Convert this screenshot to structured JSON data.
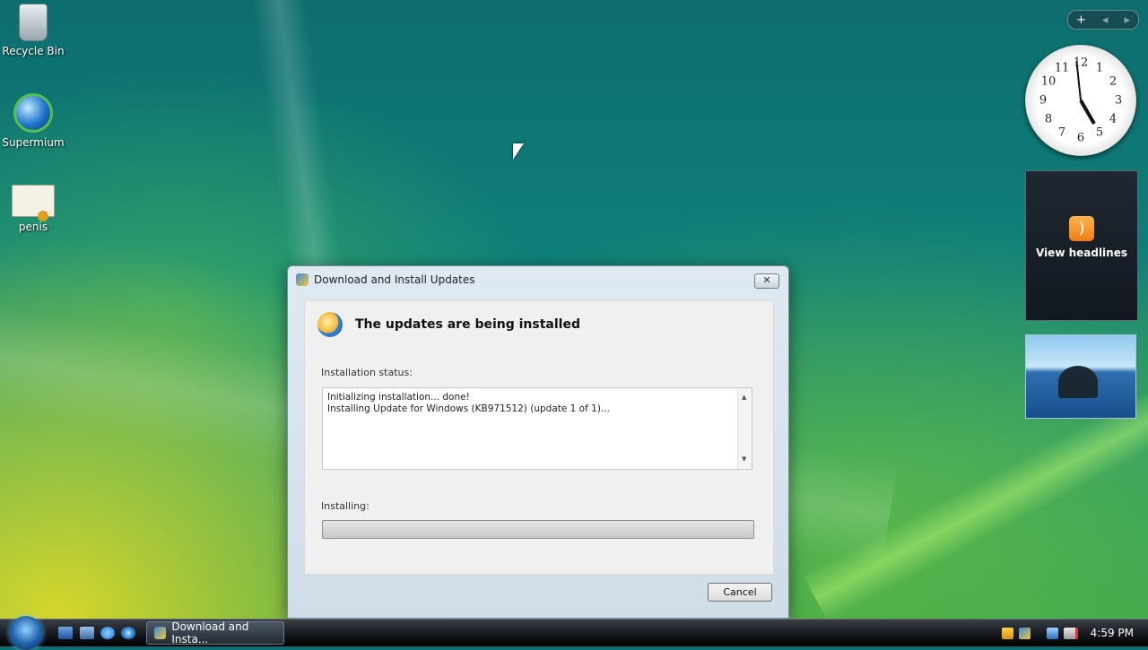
{
  "desktop": {
    "icons": [
      {
        "label": "Recycle Bin",
        "icon": "recycle-bin-icon"
      },
      {
        "label": "Supermium",
        "icon": "browser-shortcut-icon"
      },
      {
        "label": "penis",
        "icon": "certificate-file-icon"
      }
    ]
  },
  "sidebar": {
    "add_glyph": "+",
    "prev_glyph": "◂",
    "next_glyph": "▸",
    "clock_numbers": [
      "12",
      "1",
      "2",
      "3",
      "4",
      "5",
      "6",
      "7",
      "8",
      "9",
      "10",
      "11"
    ],
    "feed_label": "View headlines",
    "feed_glyph": ")"
  },
  "dialog": {
    "title": "Download and Install Updates",
    "close_glyph": "✕",
    "heading": "The updates are being installed",
    "status_label": "Installation status:",
    "log_lines": [
      "Initializing installation... done!",
      "Installing Update for Windows (KB971512) (update 1 of 1)..."
    ],
    "progress_label": "Installing:",
    "progress_fraction": 0,
    "cancel_label": "Cancel"
  },
  "taskbar": {
    "task_button_label": "Download and Insta...",
    "time": "4:59 PM"
  }
}
